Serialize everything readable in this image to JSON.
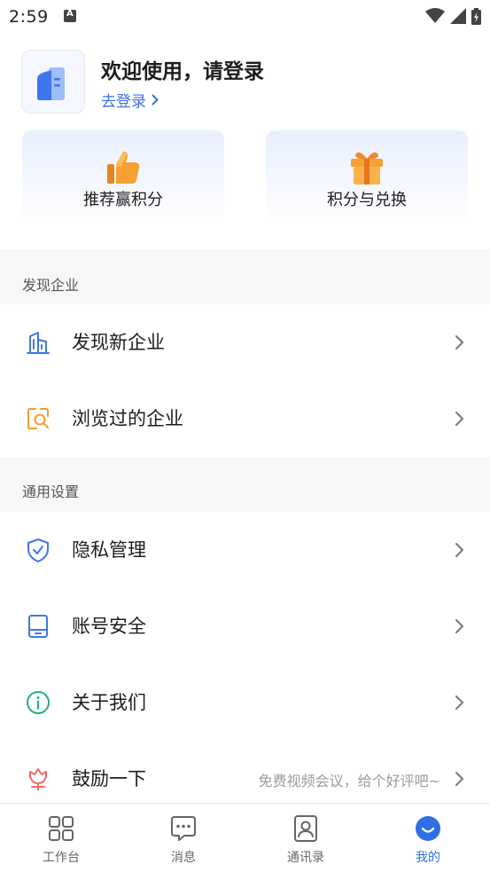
{
  "status_bar": {
    "time": "2:59",
    "icons": [
      "a-notification-icon",
      "wifi-icon",
      "signal-icon",
      "battery-charging-icon"
    ]
  },
  "profile": {
    "welcome": "欢迎使用，请登录",
    "login_link": "去登录",
    "avatar_icon": "building-logo-icon"
  },
  "cards": [
    {
      "label": "推荐赢积分",
      "icon": "thumbs-up-icon"
    },
    {
      "label": "积分与兑换",
      "icon": "gift-icon"
    }
  ],
  "sections": [
    {
      "title": "发现企业",
      "items": [
        {
          "label": "发现新企业",
          "icon": "building-icon"
        },
        {
          "label": "浏览过的企业",
          "icon": "search-folder-icon"
        }
      ]
    },
    {
      "title": "通用设置",
      "items": [
        {
          "label": "隐私管理",
          "icon": "shield-check-icon"
        },
        {
          "label": "账号安全",
          "icon": "phone-icon"
        },
        {
          "label": "关于我们",
          "icon": "info-icon"
        },
        {
          "label": "鼓励一下",
          "icon": "flower-icon",
          "hint": "免费视频会议，给个好评吧~"
        }
      ]
    }
  ],
  "tabs": [
    {
      "label": "工作台",
      "icon": "grid-icon",
      "active": false
    },
    {
      "label": "消息",
      "icon": "chat-icon",
      "active": false
    },
    {
      "label": "通讯录",
      "icon": "contacts-icon",
      "active": false
    },
    {
      "label": "我的",
      "icon": "smile-icon",
      "active": true
    }
  ],
  "colors": {
    "accent": "#2f6ee6",
    "link": "#3b6fe0",
    "section_bg": "#f6f7f9",
    "orange": "#f79a2d",
    "green": "#22b07d",
    "red": "#f06a6a"
  }
}
